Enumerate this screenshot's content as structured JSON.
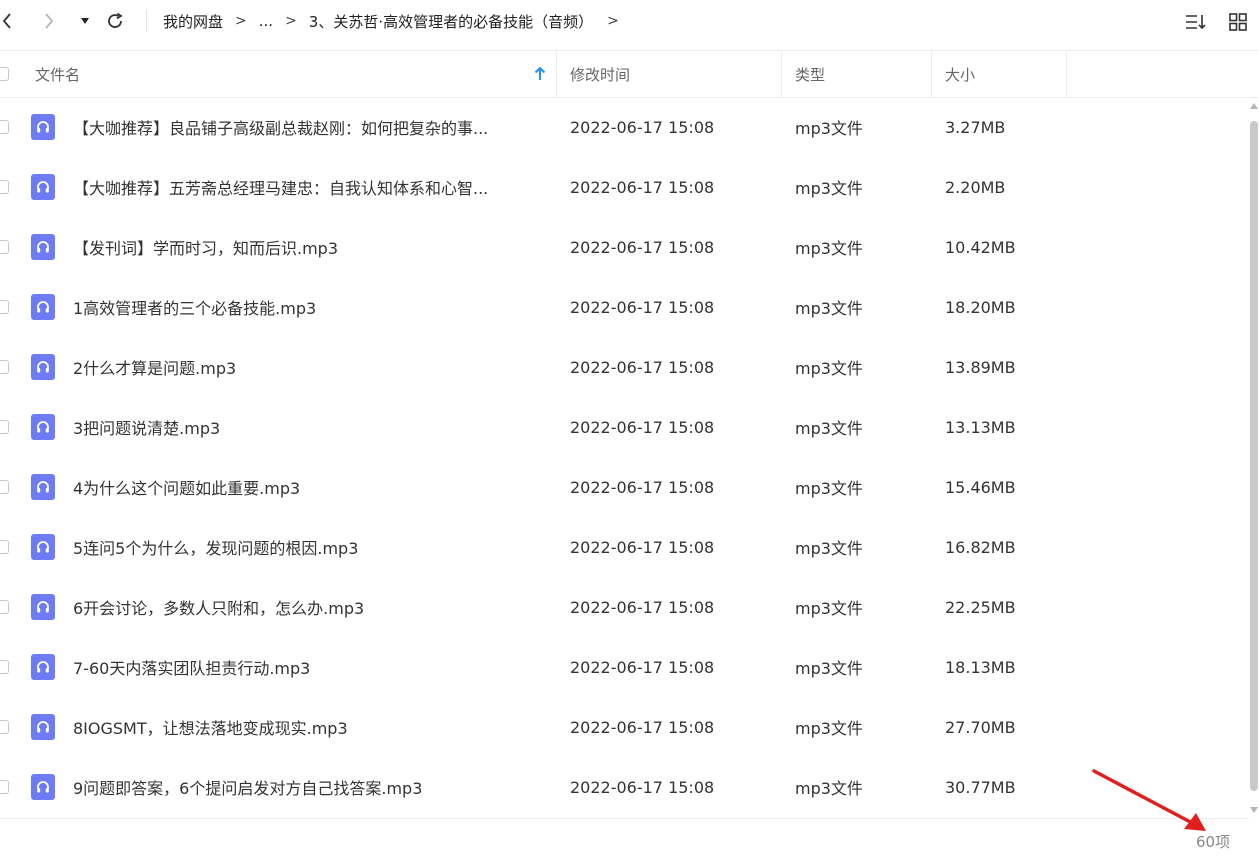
{
  "breadcrumb": {
    "root": "我的网盘",
    "sep": ">",
    "ellipsis": "...",
    "current": "3、关苏哲·高效管理者的必备技能（音频）",
    "trail_sep": ">"
  },
  "columns": {
    "name": "文件名",
    "modified": "修改时间",
    "type": "类型",
    "size": "大小"
  },
  "files": [
    {
      "name": "【大咖推荐】良品铺子高级副总裁赵刚：如何把复杂的事...",
      "modified": "2022-06-17 15:08",
      "type": "mp3文件",
      "size": "3.27MB"
    },
    {
      "name": "【大咖推荐】五芳斋总经理马建忠：自我认知体系和心智...",
      "modified": "2022-06-17 15:08",
      "type": "mp3文件",
      "size": "2.20MB"
    },
    {
      "name": "【发刊词】学而时习，知而后识.mp3",
      "modified": "2022-06-17 15:08",
      "type": "mp3文件",
      "size": "10.42MB"
    },
    {
      "name": "1高效管理者的三个必备技能.mp3",
      "modified": "2022-06-17 15:08",
      "type": "mp3文件",
      "size": "18.20MB"
    },
    {
      "name": "2什么才算是问题.mp3",
      "modified": "2022-06-17 15:08",
      "type": "mp3文件",
      "size": "13.89MB"
    },
    {
      "name": "3把问题说清楚.mp3",
      "modified": "2022-06-17 15:08",
      "type": "mp3文件",
      "size": "13.13MB"
    },
    {
      "name": "4为什么这个问题如此重要.mp3",
      "modified": "2022-06-17 15:08",
      "type": "mp3文件",
      "size": "15.46MB"
    },
    {
      "name": "5连问5个为什么，发现问题的根因.mp3",
      "modified": "2022-06-17 15:08",
      "type": "mp3文件",
      "size": "16.82MB"
    },
    {
      "name": "6开会讨论，多数人只附和，怎么办.mp3",
      "modified": "2022-06-17 15:08",
      "type": "mp3文件",
      "size": "22.25MB"
    },
    {
      "name": "7-60天内落实团队担责行动.mp3",
      "modified": "2022-06-17 15:08",
      "type": "mp3文件",
      "size": "18.13MB"
    },
    {
      "name": "8IOGSMT，让想法落地变成现实.mp3",
      "modified": "2022-06-17 15:08",
      "type": "mp3文件",
      "size": "27.70MB"
    },
    {
      "name": "9问题即答案，6个提问启发对方自己找答案.mp3",
      "modified": "2022-06-17 15:08",
      "type": "mp3文件",
      "size": "30.77MB"
    }
  ],
  "footer": {
    "count": "60项"
  },
  "colors": {
    "accent": "#1e90ff",
    "file_icon": "#6d7cf5",
    "annotation_arrow": "#e02020"
  },
  "icons": [
    "back-icon",
    "forward-icon",
    "dropdown-icon",
    "refresh-icon",
    "sort-icon",
    "grid-view-icon",
    "sort-up-arrow-icon",
    "audio-file-icon"
  ]
}
